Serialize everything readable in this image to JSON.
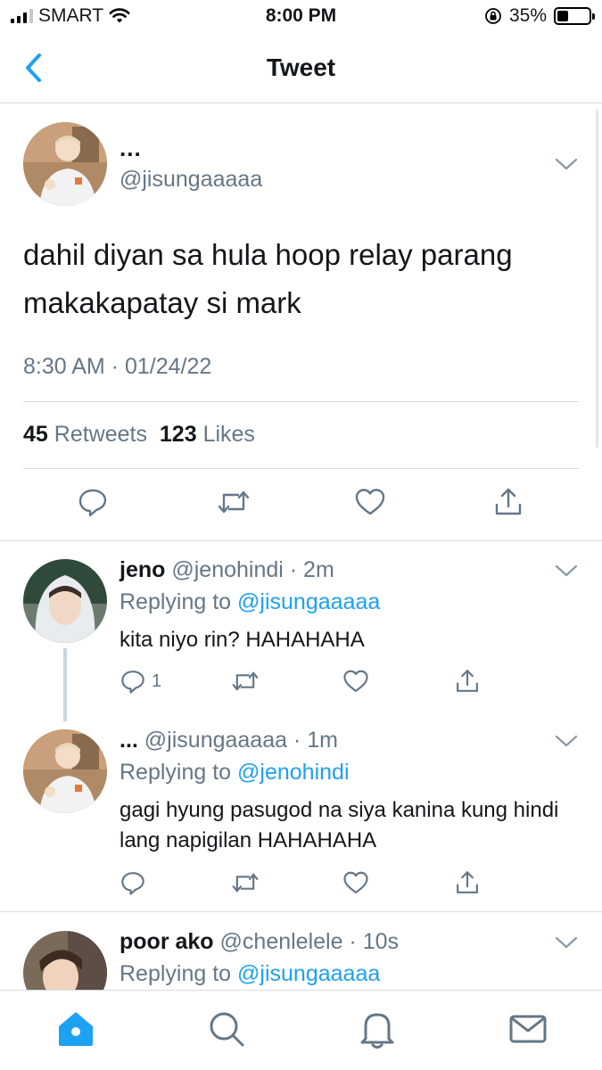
{
  "status_bar": {
    "carrier": "SMART",
    "time": "8:00 PM",
    "battery_percent": "35%",
    "battery_level": 0.35
  },
  "nav": {
    "title": "Tweet",
    "back_icon": "chevron-left-icon"
  },
  "main_tweet": {
    "display_name": "...",
    "handle": "@jisungaaaaa",
    "text": "dahil diyan sa hula hoop relay parang makakapatay si mark",
    "timestamp": "8:30 AM · 01/24/22",
    "retweets_count": "45",
    "retweets_label": "Retweets",
    "likes_count": "123",
    "likes_label": "Likes"
  },
  "replies": [
    {
      "name": "jeno",
      "handle": "@jenohindi",
      "time": "· 2m",
      "replying_prefix": "Replying to",
      "replying_to": "@jisungaaaaa",
      "text": "kita niyo rin? HAHAHAHA",
      "reply_count": "1"
    },
    {
      "name": "...",
      "handle": "@jisungaaaaa",
      "time": "· 1m",
      "replying_prefix": "Replying to",
      "replying_to": "@jenohindi",
      "text": "gagi hyung pasugod na siya kanina kung hindi lang napigilan HAHAHAHA",
      "reply_count": ""
    },
    {
      "name": "poor ako",
      "handle": "@chenlelele",
      "time": "· 10s",
      "replying_prefix": "Replying to",
      "replying_to": "@jisungaaaaa",
      "text": "",
      "reply_count": ""
    }
  ],
  "colors": {
    "accent": "#1da1f2",
    "secondary_text": "#657786",
    "divider": "#d9dde0"
  },
  "tab_bar": [
    "home-icon",
    "search-icon",
    "notifications-bell-icon",
    "messages-envelope-icon"
  ]
}
